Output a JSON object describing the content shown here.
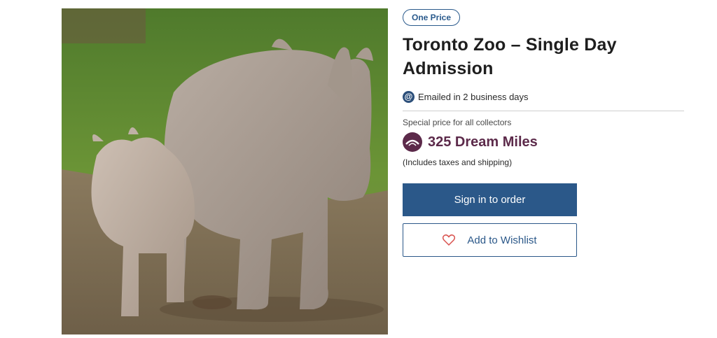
{
  "product": {
    "badge": "One Price",
    "title": "Toronto Zoo – Single Day Admission",
    "delivery_text": "Emailed in 2 business days",
    "delivery_icon": "at-sign-icon",
    "special_price_label": "Special price for all collectors",
    "price": "325 Dream Miles",
    "price_icon": "dream-miles-icon",
    "price_note": "(Includes taxes and shipping)",
    "image_alt": "Two rhinoceroses walking on dirt"
  },
  "actions": {
    "sign_in_label": "Sign in to order",
    "wishlist_label": "Add to Wishlist",
    "wishlist_icon": "heart-icon"
  },
  "colors": {
    "accent": "#2b5889",
    "price": "#5c2a4a",
    "badge": "#2a5a8c",
    "heart": "#d9534f"
  }
}
